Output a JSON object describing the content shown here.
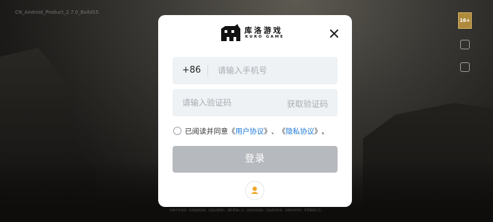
{
  "background": {
    "build_tag": "CN_Android_Product_2.7.0_Build15",
    "footer_notice": "抵制不良游戏，拒绝盗版游戏。注意自我保护，谨防受骗上当。适度游戏益脑，沉迷游戏伤身。合理安排时间，享受健康生活。"
  },
  "side": {
    "age_rating": "16+"
  },
  "modal": {
    "logo": {
      "title_cn": "库洛游戏",
      "title_en": "KURO GAME"
    },
    "phone": {
      "country_code": "+86",
      "placeholder": "请输入手机号",
      "value": ""
    },
    "code": {
      "placeholder": "请输入验证码",
      "value": "",
      "get_code_label": "获取验证码"
    },
    "agreement": {
      "prefix": "已阅读并同意",
      "open1": "《",
      "user_agreement": "用户协议",
      "close1": "》",
      "sep": "、",
      "open2": "《",
      "privacy_agreement": "隐私协议",
      "close2": "》",
      "end": "。"
    },
    "login_label": "登录"
  },
  "colors": {
    "accent_link": "#1f7bd8",
    "login_disabled": "#b6b9bd",
    "field_bg": "#eef2f5",
    "user_icon": "#f0a72a"
  }
}
